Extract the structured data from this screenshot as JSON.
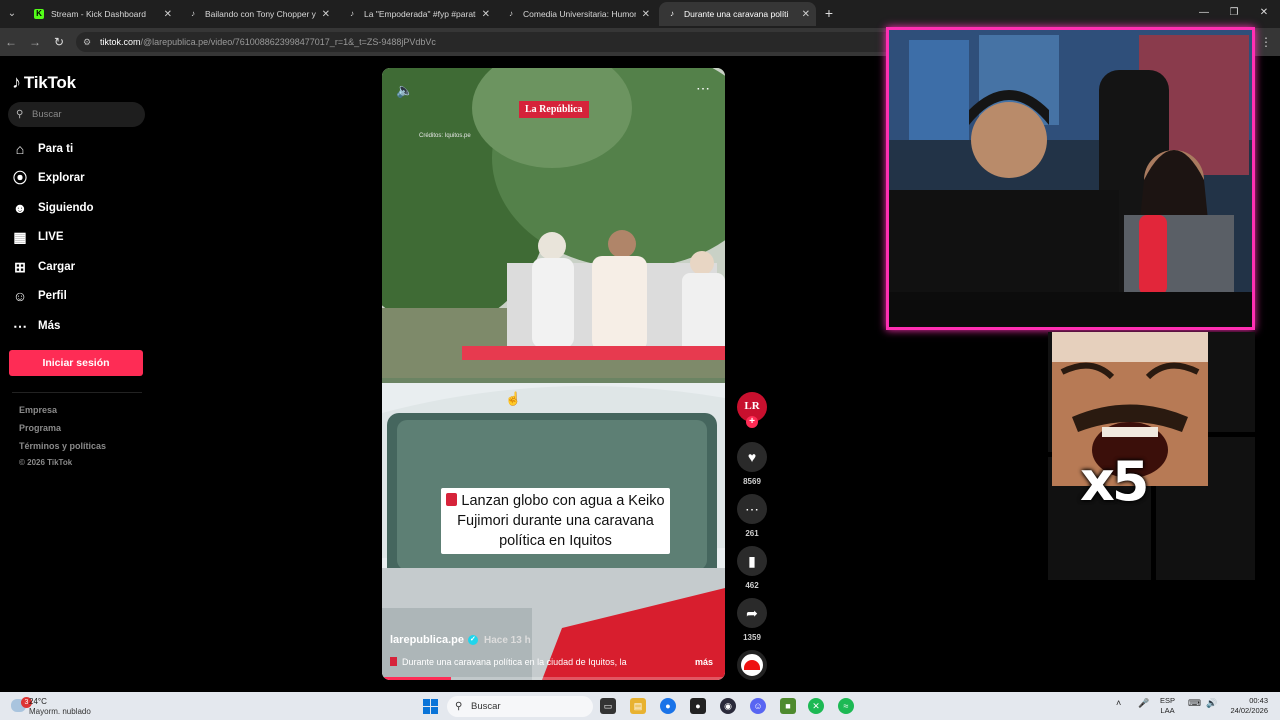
{
  "browser": {
    "tabs": [
      {
        "title": "Stream - Kick Dashboard",
        "icon": "kick-icon",
        "color": "#53fc18",
        "active": false
      },
      {
        "title": "Bailando con Tony Chopper y N",
        "icon": "tiktok-icon",
        "active": false
      },
      {
        "title": "La \"Empoderada\" #fyp #parati",
        "icon": "tiktok-icon",
        "active": false
      },
      {
        "title": "Comedia Universitaria: Humor y",
        "icon": "tiktok-icon",
        "active": false
      },
      {
        "title": "Durante una caravana políti",
        "icon": "tiktok-icon",
        "active": true
      }
    ],
    "new_tab": "+",
    "url_host": "tiktok.com",
    "url_path": "/@larepublica.pe/video/7610088623998477017_r=1&_t=ZS-9488jPVdbVc",
    "window_controls": [
      "minimize-icon",
      "restore-icon",
      "close-icon"
    ]
  },
  "tiktok": {
    "logo": "TikTok",
    "search_placeholder": "Buscar",
    "nav": [
      {
        "label": "Para ti",
        "icon": "home-icon"
      },
      {
        "label": "Explorar",
        "icon": "compass-icon"
      },
      {
        "label": "Siguiendo",
        "icon": "following-icon"
      },
      {
        "label": "LIVE",
        "icon": "live-tv-icon"
      },
      {
        "label": "Cargar",
        "icon": "upload-icon"
      },
      {
        "label": "Perfil",
        "icon": "profile-icon"
      },
      {
        "label": "Más",
        "icon": "more-dots-icon"
      }
    ],
    "login_label": "Iniciar sesión",
    "footer_links": [
      "Empresa",
      "Programa",
      "Términos y políticas"
    ],
    "copyright": "© 2026 TikTok",
    "accent": "#fe2c55"
  },
  "video": {
    "brand_badge": "La República",
    "credits": "Créditos: Iquitos.pe",
    "caption": "Lanzan globo con agua a Keiko Fujimori durante una caravana política en Iquitos",
    "author": "larepublica.pe",
    "posted": "Hace 13 h",
    "description": "Durante una caravana política en la ciudad de Iquitos, la",
    "more": "más",
    "progress": 0.2
  },
  "actions": {
    "avatar_text": "LR",
    "likes": "8569",
    "comments": "261",
    "saves": "462",
    "shares": "1359"
  },
  "overlay": {
    "multiplier": "x5",
    "frame_color": "#ff2fb3"
  },
  "taskbar": {
    "weather_badge": "3",
    "temperature": "24°C",
    "weather_text": "Mayorm. nublado",
    "search": "Buscar",
    "lang_line1": "ESP",
    "lang_line2": "LAA",
    "time": "00:43",
    "date": "24/02/2026"
  }
}
